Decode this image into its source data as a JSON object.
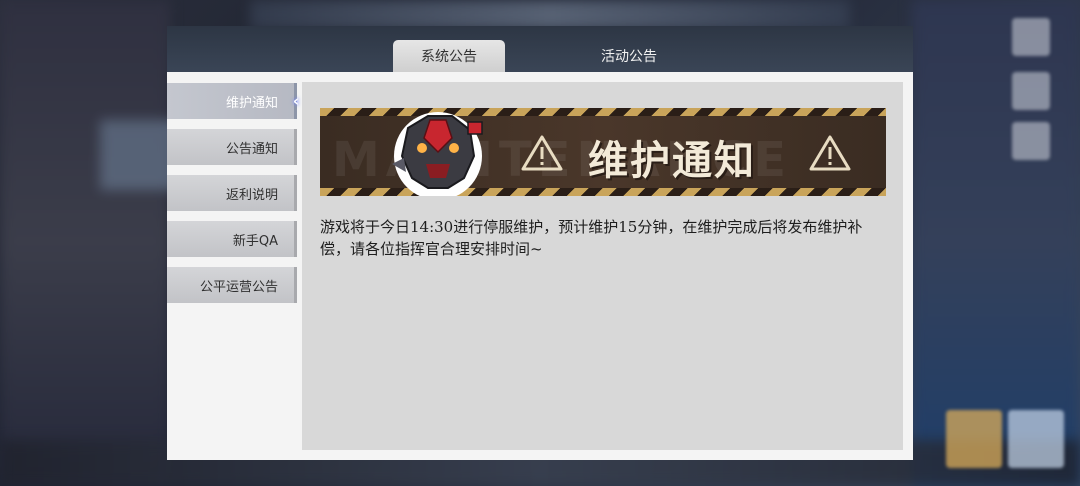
{
  "tabs": {
    "system": "系统公告",
    "event": "活动公告"
  },
  "sidebar": {
    "items": [
      {
        "label": "维护通知"
      },
      {
        "label": "公告通知"
      },
      {
        "label": "返利说明"
      },
      {
        "label": "新手QA"
      },
      {
        "label": "公平运营公告"
      }
    ]
  },
  "banner": {
    "title": "维护通知",
    "bg_text": "MAINTENANCE"
  },
  "notice": {
    "body": "游戏将于今日14:30进行停服维护，预计维护15分钟，在维护完成后将发布维护补偿，请各位指挥官合理安排时间~"
  },
  "colors": {
    "header_bg": "#2d3644",
    "content_bg": "#d8d8d8",
    "banner_gold": "#c9a45a",
    "banner_dark": "#3d2f26"
  }
}
